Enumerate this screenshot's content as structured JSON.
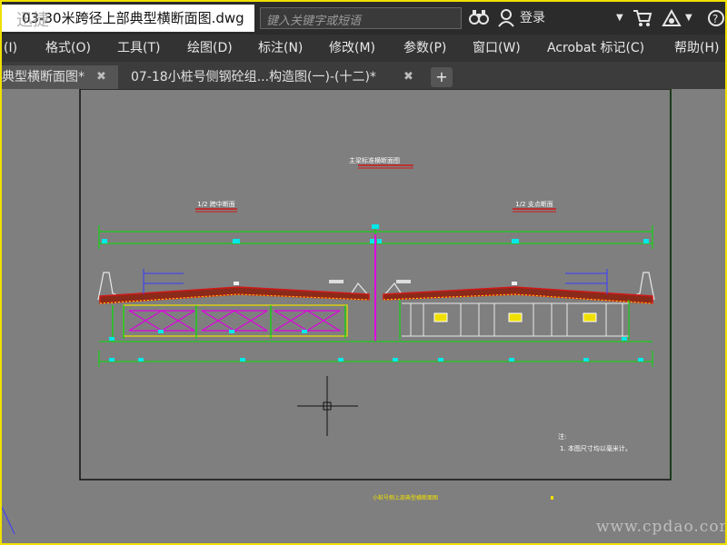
{
  "titlebar": {
    "document_title": "03-30米跨径上部典型横断面图.dwg",
    "search_placeholder": "键入关键字或短语",
    "login_label": "登录"
  },
  "menu": {
    "items": [
      "(I)",
      "格式(O)",
      "工具(T)",
      "绘图(D)",
      "标注(N)",
      "修改(M)",
      "参数(P)",
      "窗口(W)",
      "Acrobat 标记(C)",
      "帮助(H)"
    ]
  },
  "tabs": [
    {
      "label": "典型横断面图*",
      "active": true
    },
    {
      "label": "07-18小桩号侧钢砼组...构造图(一)-(十二)*",
      "active": false
    }
  ],
  "drawing": {
    "main_title": "主梁标准横断面图",
    "left_label": "1/2 跨中断面",
    "right_label": "1/2 支点断面",
    "note_heading": "注:",
    "note_text": "1. 本图尺寸均以毫米计。",
    "bottom_caption": "小桩号侧上部典型横断面图"
  },
  "watermarks": {
    "bottom_right": "www.cpdao.com",
    "top_left": "迅捷"
  },
  "colors": {
    "canvas": "#7f7f7f",
    "green": "#00e000",
    "red": "#d01818",
    "magenta": "#e000e0",
    "cyan": "#00e8e8",
    "yellow": "#f0e000",
    "border": "#f0e000"
  }
}
